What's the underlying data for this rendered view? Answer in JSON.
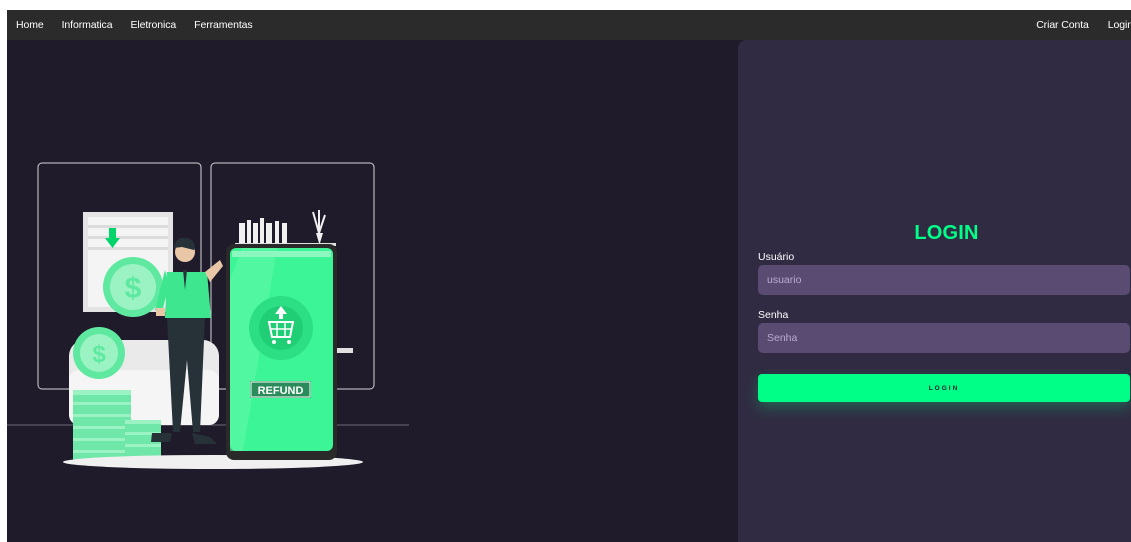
{
  "nav": {
    "left": [
      {
        "label": "Home"
      },
      {
        "label": "Informatica"
      },
      {
        "label": "Eletronica"
      },
      {
        "label": "Ferramentas"
      }
    ],
    "right": [
      {
        "label": "Criar Conta"
      },
      {
        "label": "Login"
      }
    ]
  },
  "illustration": {
    "phone_label": "REFUND",
    "icons": [
      "dollar-coin-icon",
      "download-arrow-icon",
      "shopping-cart-icon",
      "upload-arrow-icon"
    ]
  },
  "login": {
    "title": "LOGIN",
    "username_label": "Usuário",
    "username_placeholder": "usuario",
    "password_label": "Senha",
    "password_placeholder": "Senha",
    "submit_label": "LOGIN"
  },
  "colors": {
    "accent": "#00ff87",
    "page_background": "#1f1b2b",
    "panel_background": "#302b42",
    "input_background": "#5a4b73",
    "navbar": "#2b2b2b"
  }
}
